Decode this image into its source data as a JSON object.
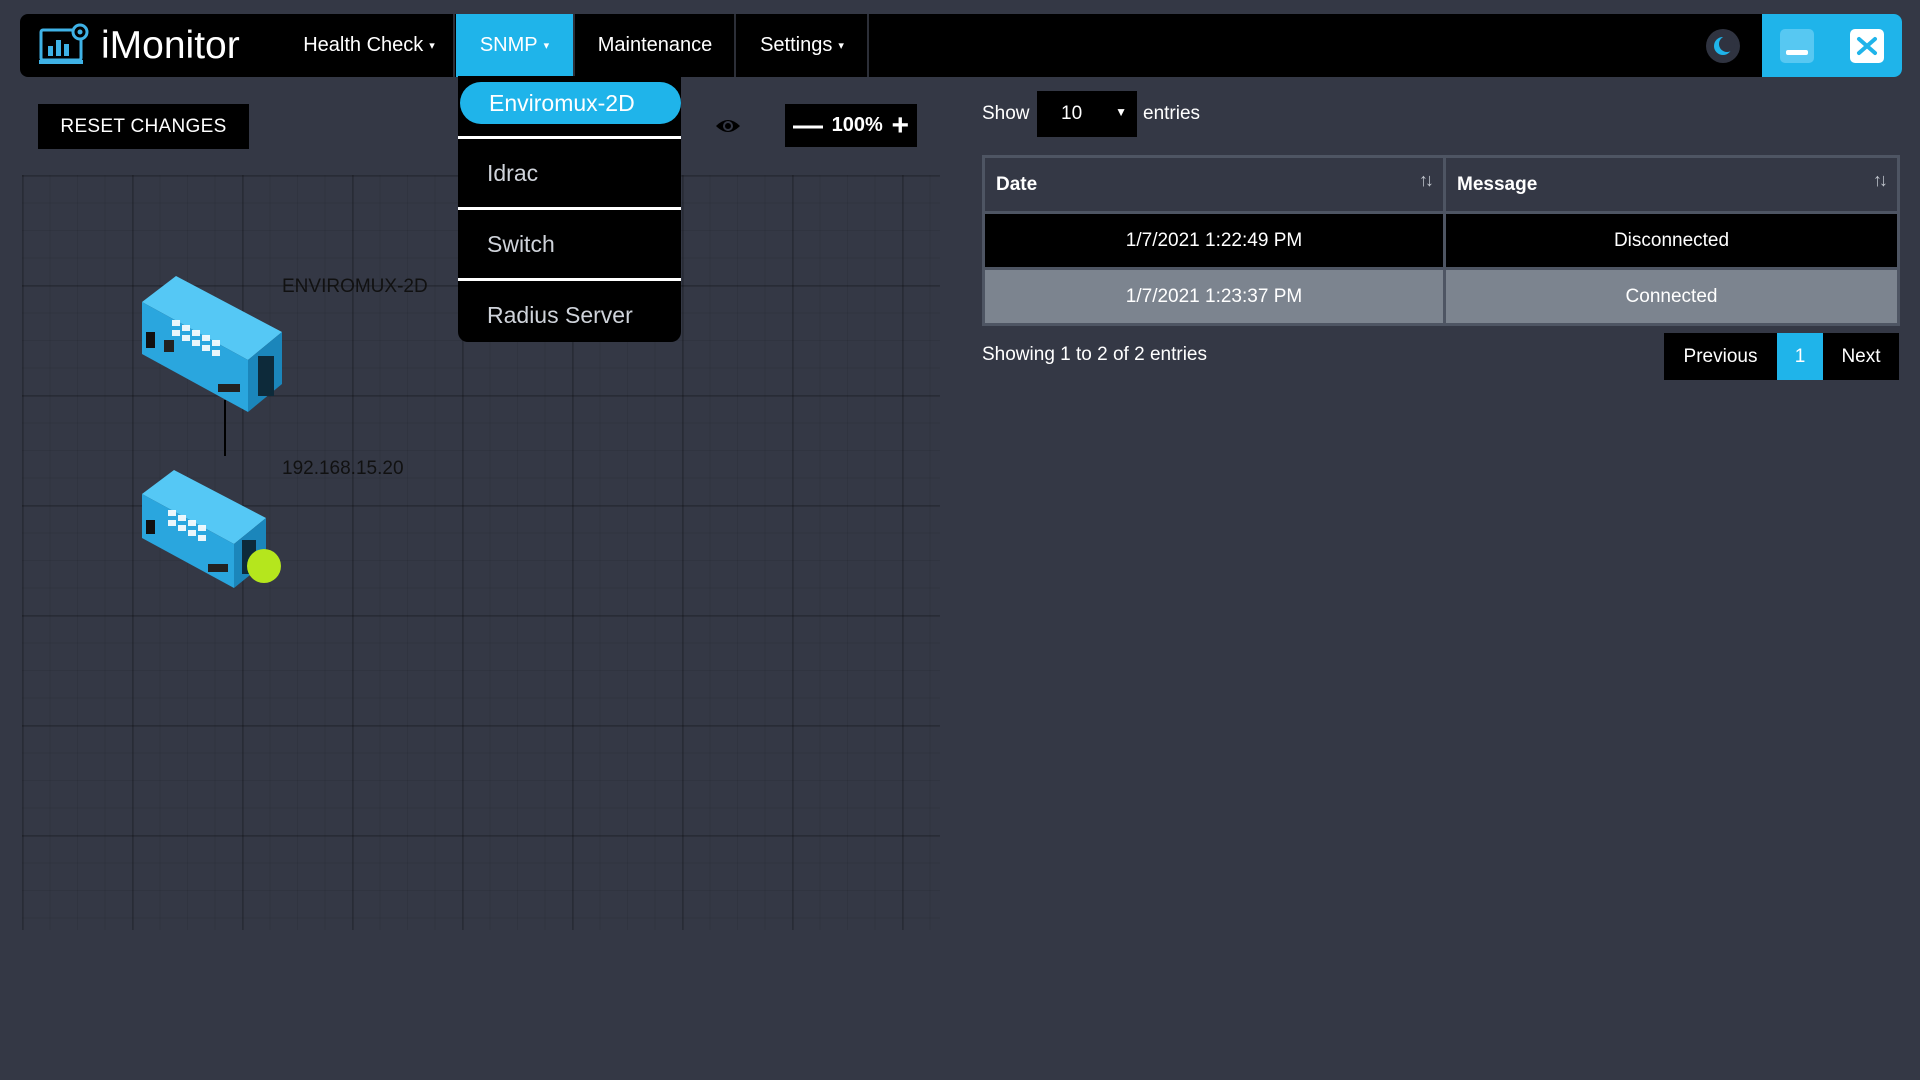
{
  "app": {
    "title": "iMonitor"
  },
  "nav": {
    "items": [
      {
        "label": "Health Check",
        "caret": "▾"
      },
      {
        "label": "SNMP",
        "caret": "▾"
      },
      {
        "label": "Maintenance"
      },
      {
        "label": "Settings",
        "caret": "▾"
      }
    ],
    "active": "SNMP"
  },
  "snmp_menu": {
    "items": [
      {
        "label": "Enviromux-2D"
      },
      {
        "label": "Idrac"
      },
      {
        "label": "Switch"
      },
      {
        "label": "Radius Server"
      }
    ],
    "selected": "Enviromux-2D"
  },
  "toolbar": {
    "reset_label": "RESET CHANGES",
    "zoom_minus": "—",
    "zoom_value": "100%",
    "zoom_plus": "+"
  },
  "diagram": {
    "devices": [
      {
        "label": "ENVIROMUX-2D"
      },
      {
        "label": "192.168.15.20",
        "status_color": "#b5e61d"
      }
    ]
  },
  "table_controls": {
    "show_label": "Show",
    "page_size": "10",
    "entries_label": "entries"
  },
  "table": {
    "columns": [
      "Date",
      "Message"
    ],
    "sort_icon": "↑↓",
    "rows": [
      {
        "date": "1/7/2021 1:22:49 PM",
        "message": "Disconnected"
      },
      {
        "date": "1/7/2021 1:23:37 PM",
        "message": "Connected"
      }
    ]
  },
  "pagination": {
    "info": "Showing 1 to 2 of 2 entries",
    "previous": "Previous",
    "current": "1",
    "next": "Next"
  },
  "icons": {
    "brand": "monitor-chart-icon",
    "theme": "moon-icon",
    "minimize": "minimize-icon",
    "close": "close-icon",
    "eye": "eye-icon",
    "sort": "sort-icon"
  },
  "colors": {
    "accent": "#1fb4ea",
    "background": "#343845",
    "status_online": "#b5e61d"
  }
}
